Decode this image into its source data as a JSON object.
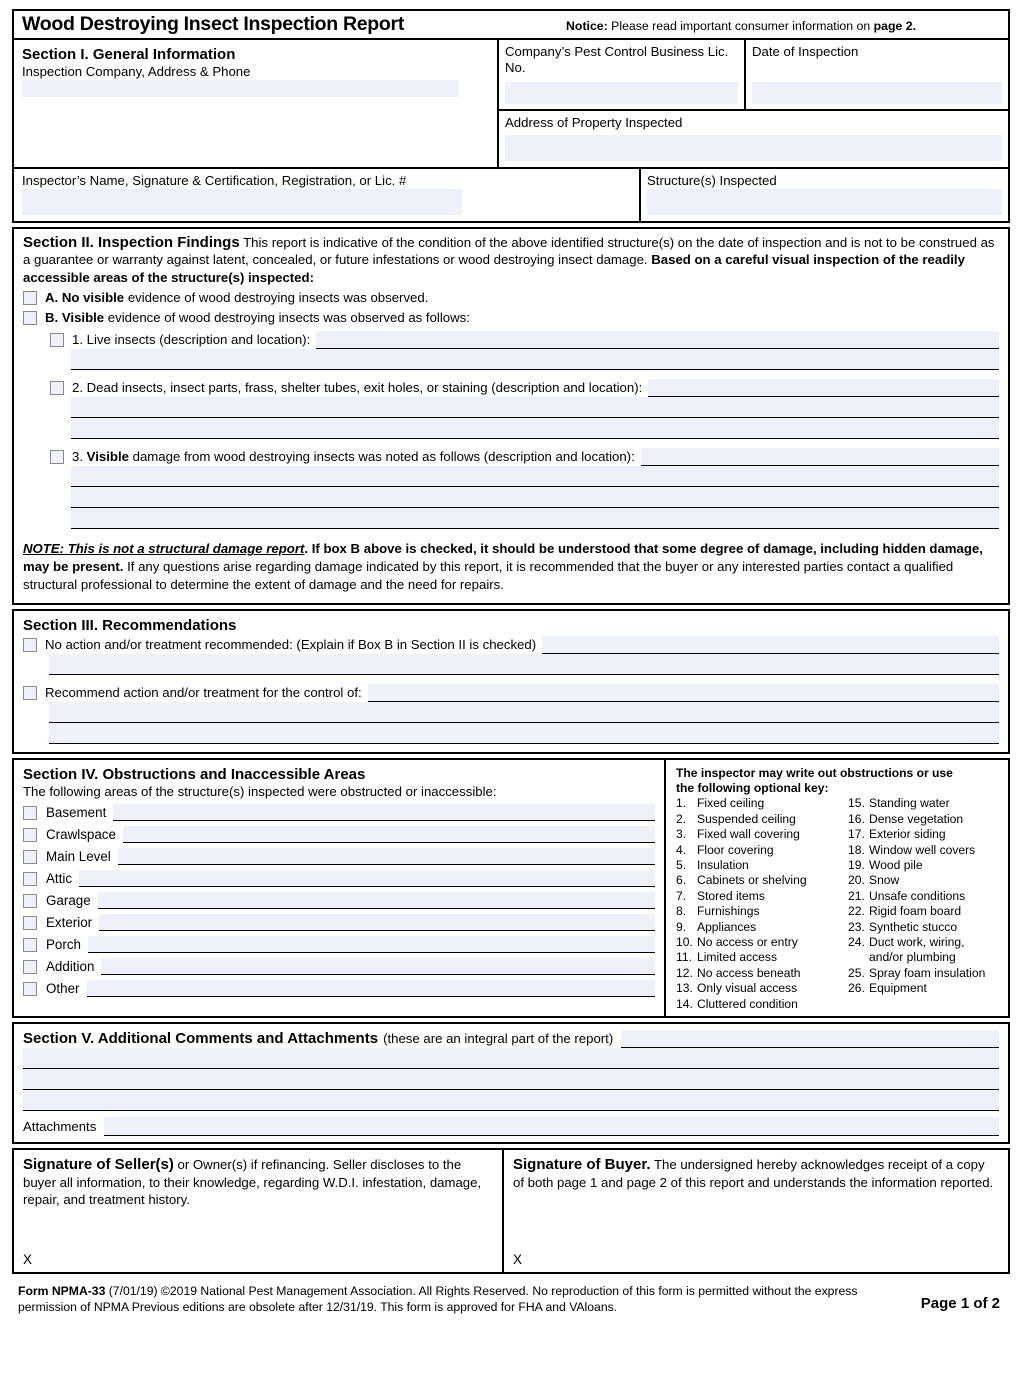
{
  "header": {
    "title": "Wood Destroying Insect Inspection Report",
    "notice_label": "Notice:",
    "notice_text": " Please read important consumer information on ",
    "notice_bold_tail": "page 2."
  },
  "section1": {
    "heading": "Section I. General Information",
    "company_label": "Inspection Company, Address & Phone",
    "lic_label": "Company’s Pest Control Business Lic. No.",
    "date_label": "Date of Inspection",
    "address_label": "Address of Property Inspected",
    "inspector_label": "Inspector’s Name, Signature & Certification, Registration, or Lic. #",
    "structure_label": "Structure(s) Inspected"
  },
  "section2": {
    "heading": "Section II. Inspection Findings",
    "intro_1": " This report is indicative of the condition of the above identified structure(s) on the date of inspection and is not to be construed as a guarantee or warranty against latent, concealed, or future infestations or wood destroying insect damage. ",
    "intro_bold": "Based on a careful visual inspection of the readily accessible areas of the structure(s) inspected:",
    "item_a_bold": "A. No visible",
    "item_a_rest": " evidence of wood destroying insects was observed.",
    "item_b_bold": "B. Visible",
    "item_b_rest": " evidence of wood destroying insects was observed as follows:",
    "sub1": "1. Live insects (description and location):",
    "sub2": "2. Dead insects, insect parts, frass, shelter tubes, exit holes, or staining (description and location):",
    "sub3_pre": "3. ",
    "sub3_bold": "Visible",
    "sub3_rest": " damage from wood destroying insects was noted as follows (description and location):",
    "note_bold_italic": "NOTE: This is not a structural damage report",
    "note_bold": ". If box B above is checked, it should be understood that some degree of damage, including hidden damage, may be present.",
    "note_rest": " If any questions arise regarding damage indicated by this report, it is recommended that the buyer or any interested parties contact a qualified structural professional to determine the extent of damage and the need for repairs."
  },
  "section3": {
    "heading": "Section III. Recommendations",
    "option1": "No action and/or treatment recommended: (Explain if Box B in Section II is checked)",
    "option2": "Recommend action and/or treatment for the control of:"
  },
  "section4": {
    "heading": "Section IV. Obstructions and Inaccessible Areas",
    "subheading": "The following areas of the structure(s) inspected were obstructed or inaccessible:",
    "areas": [
      "Basement",
      "Crawlspace",
      "Main Level",
      "Attic",
      "Garage",
      "Exterior",
      "Porch",
      "Addition",
      "Other"
    ],
    "key_title_line1": "The inspector may write out obstructions or use",
    "key_title_line2": "the following optional key:",
    "key_col1": [
      {
        "num": "1.",
        "text": "Fixed ceiling"
      },
      {
        "num": "2.",
        "text": "Suspended ceiling"
      },
      {
        "num": "3.",
        "text": "Fixed wall covering"
      },
      {
        "num": "4.",
        "text": "Floor covering"
      },
      {
        "num": "5.",
        "text": "Insulation"
      },
      {
        "num": "6.",
        "text": "Cabinets or shelving"
      },
      {
        "num": "7.",
        "text": "Stored items"
      },
      {
        "num": "8.",
        "text": "Furnishings"
      },
      {
        "num": "9.",
        "text": "Appliances"
      },
      {
        "num": "10.",
        "text": "No access or entry"
      },
      {
        "num": "11.",
        "text": "Limited access"
      },
      {
        "num": "12.",
        "text": "No access beneath"
      },
      {
        "num": "13.",
        "text": "Only visual access"
      },
      {
        "num": "14.",
        "text": "Cluttered condition"
      }
    ],
    "key_col2": [
      {
        "num": "15.",
        "text": "Standing water"
      },
      {
        "num": "16.",
        "text": "Dense vegetation"
      },
      {
        "num": "17.",
        "text": "Exterior siding"
      },
      {
        "num": "18.",
        "text": "Window well covers"
      },
      {
        "num": "19.",
        "text": "Wood pile"
      },
      {
        "num": "20.",
        "text": "Snow"
      },
      {
        "num": "21.",
        "text": "Unsafe conditions"
      },
      {
        "num": "22.",
        "text": "Rigid foam board"
      },
      {
        "num": "23.",
        "text": "Synthetic stucco"
      },
      {
        "num": "24.",
        "text": "Duct work, wiring,"
      },
      {
        "num": "",
        "text": "and/or plumbing",
        "cont": true
      },
      {
        "num": "25.",
        "text": "Spray foam insulation"
      },
      {
        "num": "26.",
        "text": "Equipment"
      }
    ]
  },
  "section5": {
    "heading": "Section V. Additional Comments and Attachments",
    "subheading": "(these are an integral part of the report)",
    "attachments_label": "Attachments"
  },
  "signatures": {
    "seller_title": "Signature of Seller(s)",
    "seller_text": " or Owner(s) if refinancing. Seller discloses to the buyer all information, to their knowledge, regarding W.D.I. infestation, damage, repair, and treatment history.",
    "buyer_title": "Signature of Buyer.",
    "buyer_text": " The undersigned hereby acknowledges receipt of a copy of both page 1 and page 2 of this report and understands the information reported.",
    "sign_mark": "X"
  },
  "footer": {
    "form_bold": "Form NPMA-33",
    "form_rest": " (7/01/19) ©2019 National Pest Management Association. All Rights Reserved. No reproduction of this form is permitted without the express permission of NPMA Previous editions are obsolete after 12/31/19. This form is approved for FHA and VAloans.",
    "page_number": "Page 1 of 2"
  },
  "colors": {
    "field_fill": "#eef0fa",
    "border": "#000000",
    "checkbox_border": "#8a8a8a"
  }
}
